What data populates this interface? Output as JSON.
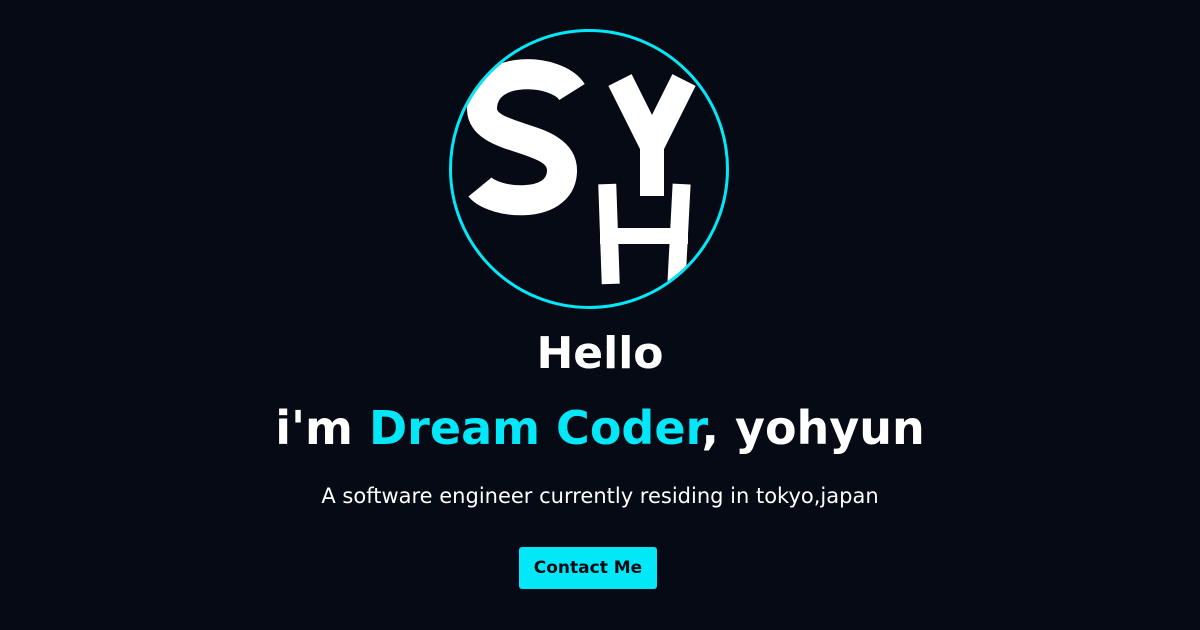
{
  "avatar": {
    "logo_text": "SYH"
  },
  "hero": {
    "greeting": "Hello",
    "headline_prefix": "i'm ",
    "headline_accent": "Dream Coder",
    "headline_suffix": ", yohyun",
    "subtitle": "A software engineer currently residing in tokyo,japan",
    "contact_label": "Contact Me"
  },
  "colors": {
    "background": "#050a14",
    "accent": "#03e8f9",
    "text": "#ffffff"
  }
}
